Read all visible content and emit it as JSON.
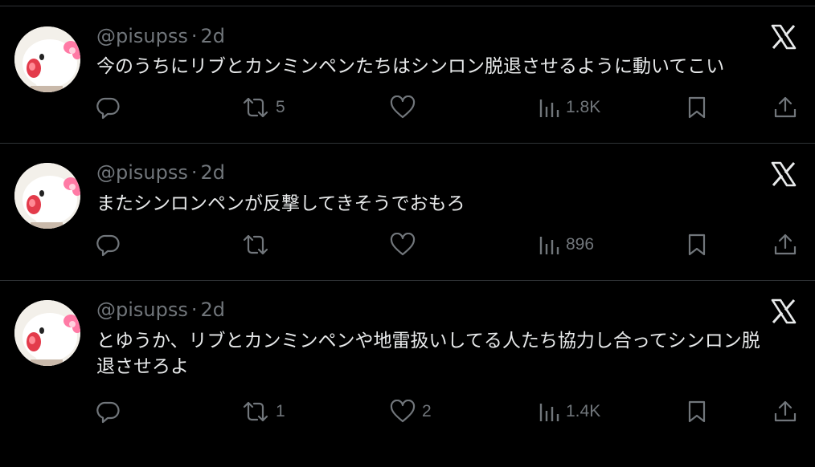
{
  "tweets": [
    {
      "handle": "@pisupss",
      "separator": "·",
      "age": "2d",
      "text": "今のうちにリブとカンミンペンたちはシンロン脱退させるように動いてこい",
      "replies": "",
      "reposts": "5",
      "likes": "",
      "views": "1.8K"
    },
    {
      "handle": "@pisupss",
      "separator": "·",
      "age": "2d",
      "text": "またシンロンペンが反撃してきそうでおもろ",
      "replies": "",
      "reposts": "",
      "likes": "",
      "views": "896"
    },
    {
      "handle": "@pisupss",
      "separator": "·",
      "age": "2d",
      "text": "とゆうか、リブとカンミンペンや地雷扱いしてる人たち協力し合ってシンロン脱\n退させろよ",
      "replies": "",
      "reposts": "1",
      "likes": "2",
      "views": "1.4K"
    }
  ],
  "icons": {
    "reply": "reply-icon",
    "repost": "repost-icon",
    "like": "heart-icon",
    "views": "views-icon",
    "bookmark": "bookmark-icon",
    "share": "share-icon",
    "brand": "x-logo-icon"
  },
  "colors": {
    "background": "#000000",
    "text": "#e7e9ea",
    "muted": "#71767b",
    "divider": "#2f3336"
  }
}
